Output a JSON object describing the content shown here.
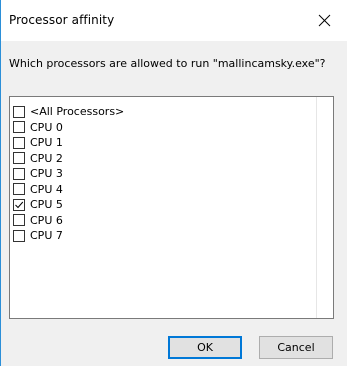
{
  "window": {
    "title": "Processor affinity",
    "close_icon": "close-icon"
  },
  "prompt": "Which processors are allowed to run \"mallincamsky.exe\"?",
  "processors": [
    {
      "label": "<All Processors>",
      "checked": false
    },
    {
      "label": "CPU 0",
      "checked": false
    },
    {
      "label": "CPU 1",
      "checked": false
    },
    {
      "label": "CPU 2",
      "checked": false
    },
    {
      "label": "CPU 3",
      "checked": false
    },
    {
      "label": "CPU 4",
      "checked": false
    },
    {
      "label": "CPU 5",
      "checked": true
    },
    {
      "label": "CPU 6",
      "checked": false
    },
    {
      "label": "CPU 7",
      "checked": false
    }
  ],
  "buttons": {
    "ok": "OK",
    "cancel": "Cancel"
  },
  "colors": {
    "accent": "#0078d7",
    "dialog_body": "#f0f0f0"
  }
}
